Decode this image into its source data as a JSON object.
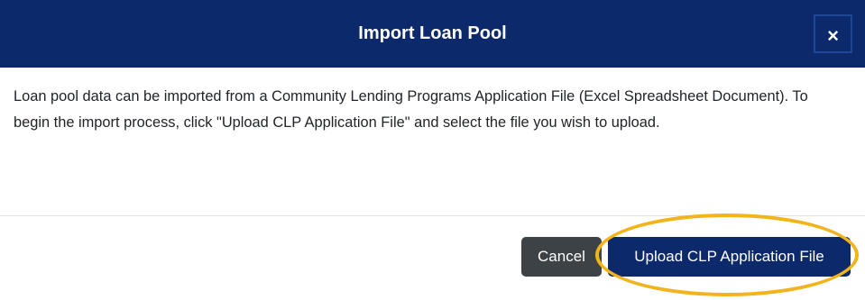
{
  "dialog": {
    "title": "Import Loan Pool",
    "close_icon": "close-icon",
    "close_glyph": "×",
    "body_text": "Loan pool data can be imported from a Community Lending Programs Application File (Excel Spreadsheet Document). To begin the import process, click \"Upload CLP Application File\" and select the file you wish to upload."
  },
  "footer": {
    "cancel_label": "Cancel",
    "upload_label": "Upload CLP Application File"
  },
  "colors": {
    "header_bg": "#0c2a6b",
    "cancel_bg": "#3d4247",
    "upload_bg": "#0c2a6b",
    "highlight_ring": "#f2b31b"
  }
}
